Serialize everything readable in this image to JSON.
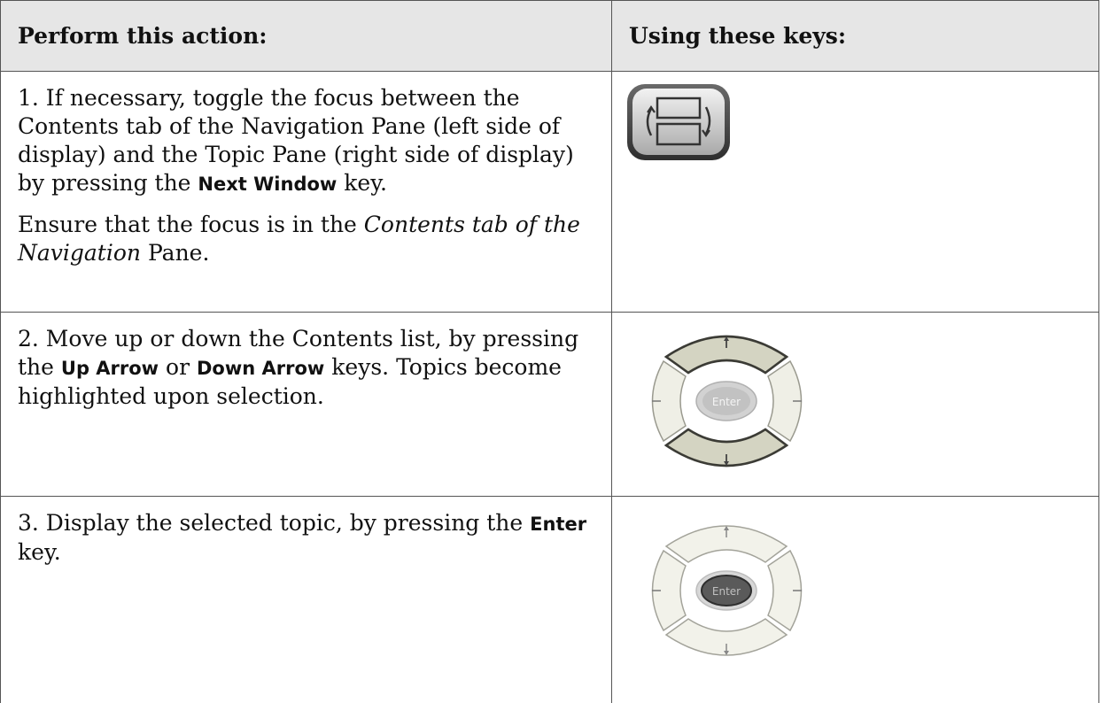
{
  "table": {
    "headers": {
      "action": "Perform this action:",
      "keys": "Using these keys:"
    },
    "rows": [
      {
        "p1_a": "1. If necessary, toggle the focus between the Contents tab of the Navigation Pane (left side of display) and the Topic Pane (right side of display) by pressing the ",
        "p1_key": "Next Window",
        "p1_b": " key.",
        "p2_a": "Ensure that the focus is in the ",
        "p2_em": "Contents tab of the Navigation",
        "p2_b": " Pane.",
        "icon": "next-window-key-icon"
      },
      {
        "p1_a": "2. Move up or down the Contents list, by pressing the ",
        "key1": "Up Arrow",
        "mid": " or ",
        "key2": "Down Arrow",
        "p1_b": " keys. Topics become highlighted upon selection.",
        "icon": "arrow-keypad-up-down-highlighted-icon",
        "enter_label": "Enter"
      },
      {
        "p1_a": "3. Display the selected topic, by pressing the ",
        "key": "Enter",
        "p1_b": " key.",
        "icon": "arrow-keypad-enter-highlighted-icon",
        "enter_label": "Enter"
      }
    ]
  }
}
